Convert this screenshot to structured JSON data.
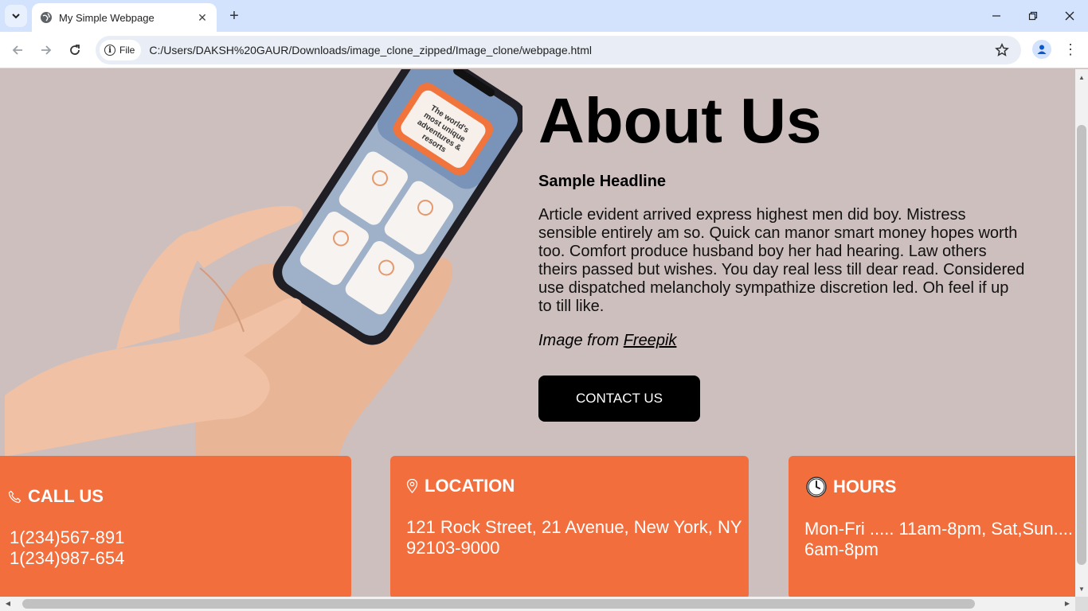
{
  "browser": {
    "tab_title": "My Simple Webpage",
    "chip_label": "File",
    "url": "C:/Users/DAKSH%20GAUR/Downloads/image_clone_zipped/Image_clone/webpage.html",
    "accent": "#d3e3fd"
  },
  "page": {
    "heading": "About Us",
    "subheading": "Sample Headline",
    "body": "Article evident arrived express highest men did boy. Mistress sensible entirely am so. Quick can manor smart money hopes worth too. Comfort produce husband boy her had hearing. Law others theirs passed but wishes. You day real less till dear read. Considered use dispatched melancholy sympathize discretion led. Oh feel if up to till like.",
    "credit_prefix": "Image from ",
    "credit_link": "Freepik",
    "button_label": "CONTACT US",
    "image_screen_text": "The world's most unique adventures & resorts"
  },
  "cards": {
    "call": {
      "title": "CALL US",
      "line1": "1(234)567-891",
      "line2": "1(234)987-654",
      "icon": "phone-icon"
    },
    "location": {
      "title": "LOCATION",
      "line1": "121 Rock Street, 21 Avenue, New York, NY",
      "line2": "92103-9000",
      "icon": "map-pin-icon"
    },
    "hours": {
      "title": "HOURS",
      "line1": "Mon-Fri ..... 11am-8pm, Sat,Sun....",
      "line2": "6am-8pm",
      "icon": "clock-icon"
    }
  },
  "colors": {
    "page_bg": "#cdbfbe",
    "card_bg": "#f26e3c",
    "button_bg": "#000000"
  }
}
